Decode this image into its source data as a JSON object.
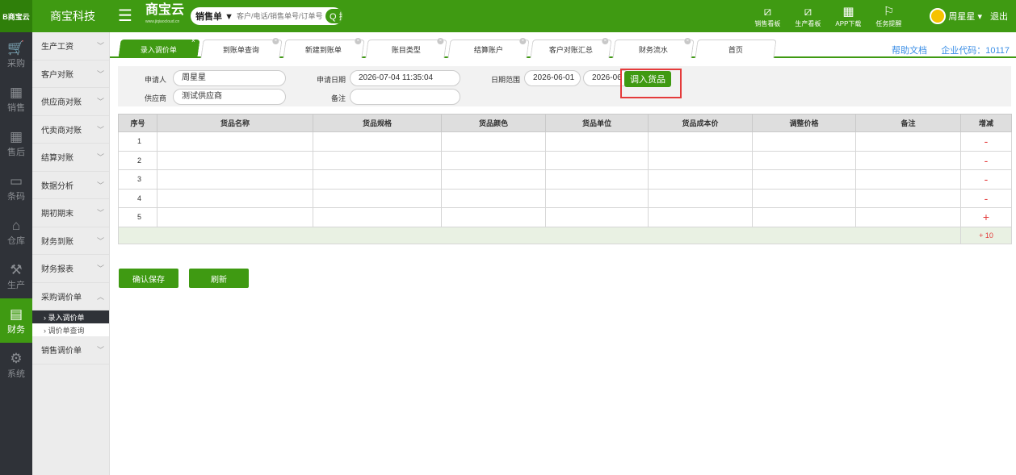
{
  "header": {
    "logo_text": "B商宝云",
    "company": "商宝科技",
    "brand": "商宝云",
    "brand_url": "www.jiqiaocloud.cn",
    "search": {
      "type_label": "销售单 ▼",
      "placeholder": "客户/电话/销售单号/订单号",
      "button_label": "Q 搜索"
    },
    "tools": [
      {
        "label": "销售看板",
        "icon": "chart-icon"
      },
      {
        "label": "生产看板",
        "icon": "chart-icon"
      },
      {
        "label": "APP下载",
        "icon": "qrcode-icon"
      },
      {
        "label": "任务提醒",
        "icon": "flag-icon"
      }
    ],
    "user_name": "周星星 ▾",
    "logout": "退出"
  },
  "iconbar": [
    {
      "label": "采购",
      "icon": "cart-icon"
    },
    {
      "label": "销售",
      "icon": "grid-icon"
    },
    {
      "label": "售后",
      "icon": "grid-icon"
    },
    {
      "label": "条码",
      "icon": "barcode-icon"
    },
    {
      "label": "仓库",
      "icon": "warehouse-icon"
    },
    {
      "label": "生产",
      "icon": "robot-arm-icon"
    },
    {
      "label": "财务",
      "icon": "calculator-icon",
      "active": true
    },
    {
      "label": "系统",
      "icon": "gear-icon"
    }
  ],
  "sidebar": {
    "items": [
      "生产工资",
      "客户对账",
      "供应商对账",
      "代卖商对账",
      "结算对账",
      "数据分析",
      "期初期末",
      "财务到账",
      "财务报表",
      "采购调价单"
    ],
    "sub_items": [
      "› 录入调价单",
      "› 调价单查询"
    ],
    "last_item": "销售调价单"
  },
  "tabs": [
    "录入调价单",
    "到账单查询",
    "新建到账单",
    "账目类型",
    "结算账户",
    "客户对账汇总",
    "财务流水",
    "首页"
  ],
  "help_link": "帮助文档",
  "company_code": "企业代码：10117",
  "form": {
    "applicant_label": "申请人",
    "applicant_value": "周星星",
    "supplier_label": "供应商",
    "supplier_value": "测试供应商",
    "apply_date_label": "申请日期",
    "apply_date_value": "2026-07-04 11:35:04",
    "remark_label": "备注",
    "remark_value": "",
    "date_range_label": "日期范围",
    "date_from": "2026-06-01",
    "date_to": "2026-06",
    "import_button": "调入货品"
  },
  "table": {
    "columns": [
      "序号",
      "货品名称",
      "货品规格",
      "货品颜色",
      "货品单位",
      "货品成本价",
      "调整价格",
      "备注",
      "增减"
    ],
    "rows": [
      {
        "no": "1",
        "op": "-"
      },
      {
        "no": "2",
        "op": "-"
      },
      {
        "no": "3",
        "op": "-"
      },
      {
        "no": "4",
        "op": "-"
      },
      {
        "no": "5",
        "op": "+"
      }
    ],
    "footer_op": "+ 10"
  },
  "actions": {
    "save": "确认保存",
    "refresh": "刷新"
  }
}
